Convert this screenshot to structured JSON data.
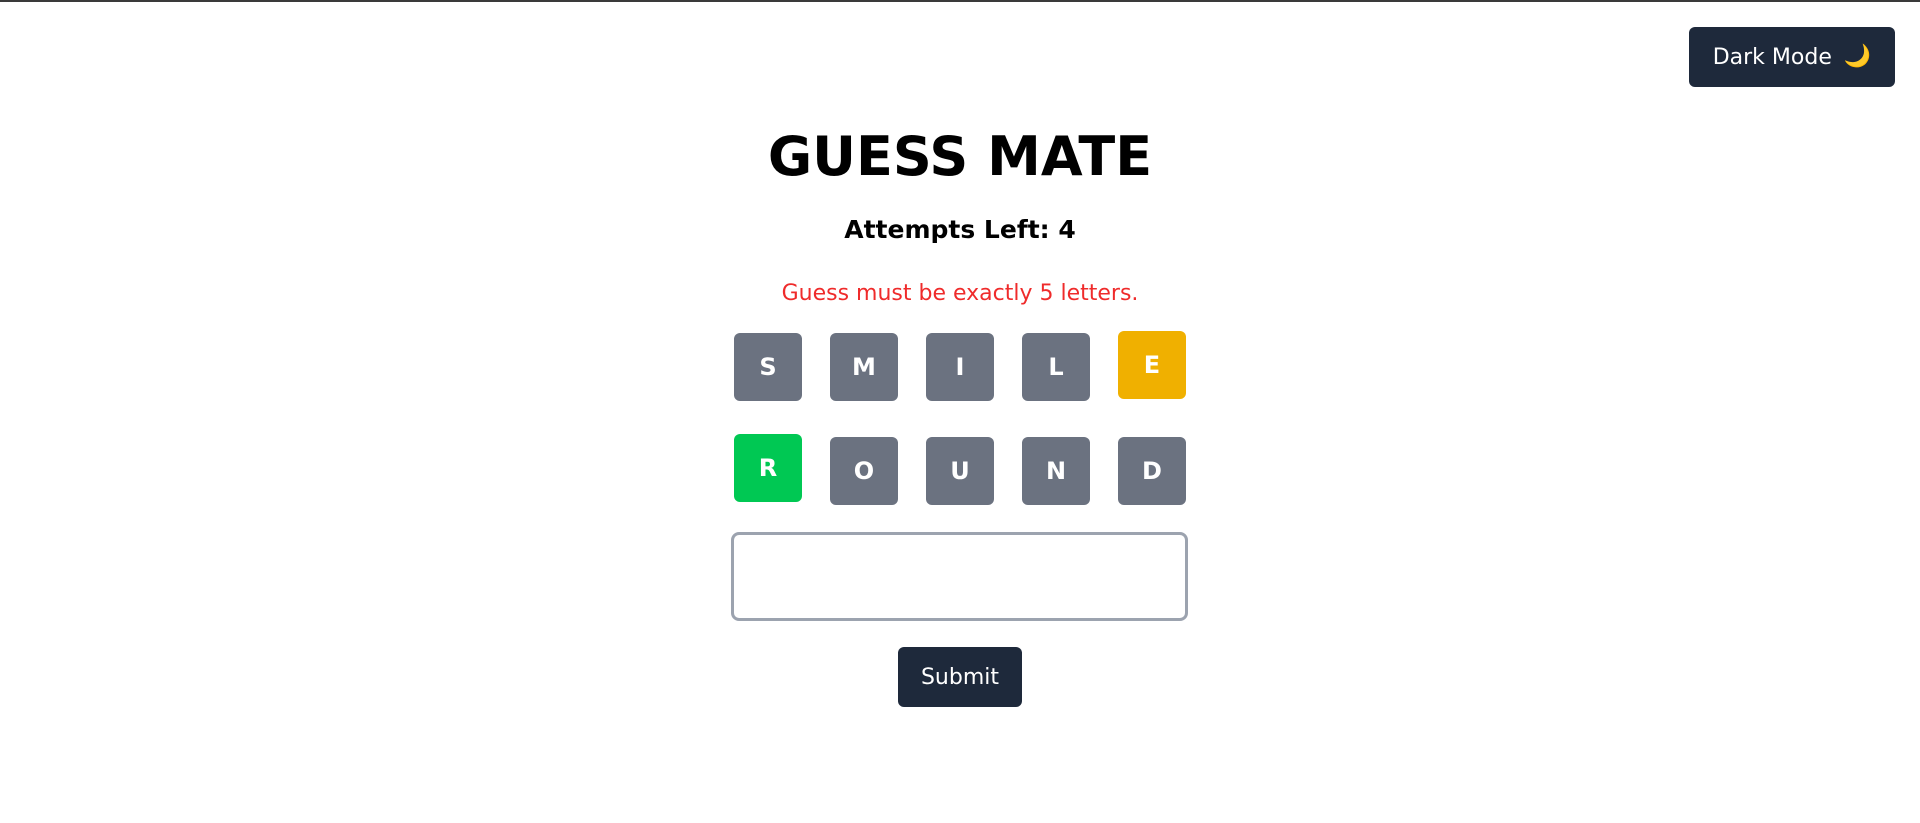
{
  "header": {
    "dark_mode_label": "Dark Mode",
    "dark_mode_icon": "🌙"
  },
  "game": {
    "title": "GUESS MATE",
    "attempts_text": "Attempts Left: 4",
    "error_message": "Guess must be exactly 5 letters.",
    "rows": [
      [
        {
          "letter": "S",
          "state": "absent"
        },
        {
          "letter": "M",
          "state": "absent"
        },
        {
          "letter": "I",
          "state": "absent"
        },
        {
          "letter": "L",
          "state": "absent"
        },
        {
          "letter": "E",
          "state": "present"
        }
      ],
      [
        {
          "letter": "R",
          "state": "correct"
        },
        {
          "letter": "O",
          "state": "absent"
        },
        {
          "letter": "U",
          "state": "absent"
        },
        {
          "letter": "N",
          "state": "absent"
        },
        {
          "letter": "D",
          "state": "absent"
        }
      ]
    ],
    "input_value": "",
    "input_placeholder": "",
    "submit_label": "Submit"
  },
  "colors": {
    "absent": "#6b7280",
    "present": "#f0b000",
    "correct": "#00c853",
    "button_bg": "#1e293b",
    "error_text": "#ef2b2b"
  }
}
